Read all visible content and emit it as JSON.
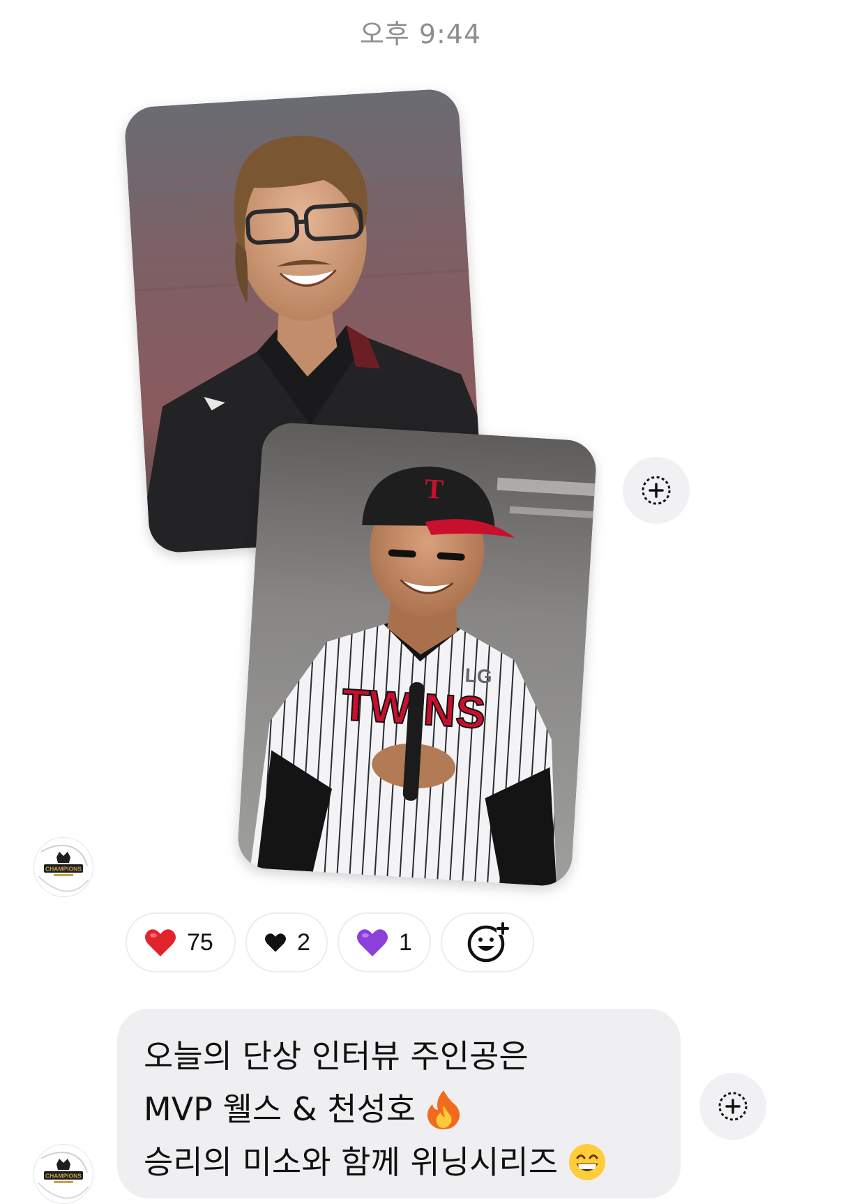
{
  "header": {
    "timestamp": "오후 9:44"
  },
  "photos": [
    {
      "icon": "smiling-man-glasses-photo"
    },
    {
      "icon": "smiling-baseball-player-photo",
      "jersey_text": "TWINS",
      "team_logo": "LG"
    }
  ],
  "add_button": {
    "icon": "add-reaction-circle-icon"
  },
  "avatar": {
    "icon": "champions-logo-avatar",
    "text": "CHAMPIONS"
  },
  "reactions": [
    {
      "emoji": "red-heart-icon",
      "count": "75",
      "color": "#e0242e"
    },
    {
      "emoji": "black-heart-icon",
      "count": "2",
      "color": "#111111"
    },
    {
      "emoji": "purple-heart-icon",
      "count": "1",
      "color": "#8b3fdb"
    }
  ],
  "reaction_add": {
    "icon": "add-emoji-icon"
  },
  "message": {
    "line1": "오늘의 단상 인터뷰 주인공은",
    "line2": "MVP 웰스 & 천성호",
    "line2_emoji": "fire-icon",
    "line3": "승리의 미소와 함께 위닝시리즈",
    "line3_emoji": "grinning-face-icon"
  },
  "colors": {
    "bubble_bg": "#efeff1",
    "timestamp": "#8e8e8e",
    "button_bg": "#f1f1f3"
  }
}
